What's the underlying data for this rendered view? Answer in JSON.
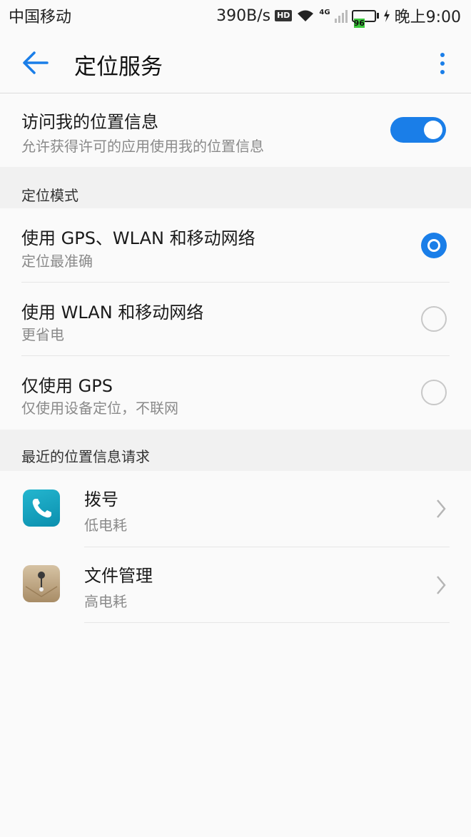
{
  "status_bar": {
    "carrier": "中国移动",
    "speed": "390B/s",
    "hd": "HD",
    "network": "4G",
    "battery": "96",
    "time": "晚上9:00"
  },
  "app_bar": {
    "title": "定位服务"
  },
  "location_access": {
    "title": "访问我的位置信息",
    "subtitle": "允许获得许可的应用使用我的位置信息",
    "enabled": true
  },
  "mode_section": {
    "header": "定位模式",
    "options": [
      {
        "title": "使用 GPS、WLAN 和移动网络",
        "subtitle": "定位最准确",
        "selected": true
      },
      {
        "title": "使用 WLAN 和移动网络",
        "subtitle": "更省电",
        "selected": false
      },
      {
        "title": "仅使用 GPS",
        "subtitle": "仅使用设备定位，不联网",
        "selected": false
      }
    ]
  },
  "recent_section": {
    "header": "最近的位置信息请求",
    "apps": [
      {
        "name": "拨号",
        "usage": "低电耗",
        "icon": "phone-icon"
      },
      {
        "name": "文件管理",
        "usage": "高电耗",
        "icon": "file-manager-icon"
      }
    ]
  },
  "colors": {
    "accent": "#1a7ee8",
    "background": "#fafafa",
    "section_bg": "#f1f1f1"
  }
}
